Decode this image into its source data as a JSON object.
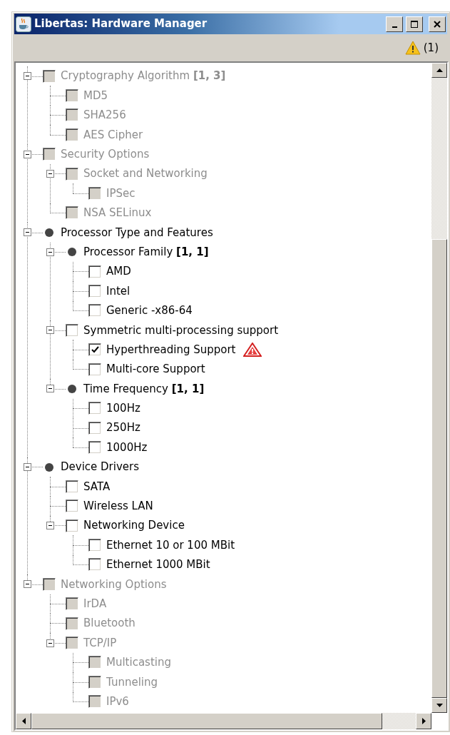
{
  "window": {
    "title": "Libertas: Hardware Manager"
  },
  "toolbar": {
    "warning_count": "(1)"
  },
  "tree": [
    {
      "label": "Cryptography Algorithm **[1, 3]**",
      "kind": "option",
      "disabled": true,
      "checked": false,
      "warning": false,
      "expanded": true,
      "children": [
        {
          "label": "MD5",
          "kind": "option",
          "disabled": true,
          "checked": false,
          "warning": false
        },
        {
          "label": "SHA256",
          "kind": "option",
          "disabled": true,
          "checked": false,
          "warning": false
        },
        {
          "label": "AES Cipher",
          "kind": "option",
          "disabled": true,
          "checked": false,
          "warning": false
        }
      ]
    },
    {
      "label": "Security Options",
      "kind": "option",
      "disabled": true,
      "checked": false,
      "warning": false,
      "expanded": true,
      "children": [
        {
          "label": "Socket and Networking",
          "kind": "option",
          "disabled": true,
          "checked": false,
          "warning": false,
          "expanded": true,
          "children": [
            {
              "label": "IPSec",
              "kind": "option",
              "disabled": true,
              "checked": false,
              "warning": false
            }
          ]
        },
        {
          "label": "NSA SELinux",
          "kind": "option",
          "disabled": true,
          "checked": false,
          "warning": false
        }
      ]
    },
    {
      "label": "Processor Type and Features",
      "kind": "group",
      "disabled": false,
      "warning": false,
      "expanded": true,
      "children": [
        {
          "label": "Processor Family **[1, 1]**",
          "kind": "group",
          "disabled": false,
          "warning": false,
          "expanded": true,
          "children": [
            {
              "label": "AMD",
              "kind": "option",
              "disabled": false,
              "checked": false,
              "warning": false
            },
            {
              "label": "Intel",
              "kind": "option",
              "disabled": false,
              "checked": false,
              "warning": false
            },
            {
              "label": "Generic -x86-64",
              "kind": "option",
              "disabled": false,
              "checked": false,
              "warning": false
            }
          ]
        },
        {
          "label": "Symmetric multi-processing support",
          "kind": "option",
          "disabled": false,
          "checked": false,
          "warning": false,
          "expanded": true,
          "children": [
            {
              "label": "Hyperthreading Support",
              "kind": "option",
              "disabled": false,
              "checked": true,
              "warning": true
            },
            {
              "label": "Multi-core Support",
              "kind": "option",
              "disabled": false,
              "checked": false,
              "warning": false
            }
          ]
        },
        {
          "label": "Time Frequency **[1, 1]**",
          "kind": "group",
          "disabled": false,
          "warning": false,
          "expanded": true,
          "children": [
            {
              "label": "100Hz",
              "kind": "option",
              "disabled": false,
              "checked": false,
              "warning": false
            },
            {
              "label": "250Hz",
              "kind": "option",
              "disabled": false,
              "checked": false,
              "warning": false
            },
            {
              "label": "1000Hz",
              "kind": "option",
              "disabled": false,
              "checked": false,
              "warning": false
            }
          ]
        }
      ]
    },
    {
      "label": "Device Drivers",
      "kind": "group",
      "disabled": false,
      "warning": false,
      "expanded": true,
      "children": [
        {
          "label": "SATA",
          "kind": "option",
          "disabled": false,
          "checked": false,
          "warning": false
        },
        {
          "label": "Wireless LAN",
          "kind": "option",
          "disabled": false,
          "checked": false,
          "warning": false
        },
        {
          "label": "Networking Device",
          "kind": "option",
          "disabled": false,
          "checked": false,
          "warning": false,
          "expanded": true,
          "children": [
            {
              "label": "Ethernet 10 or 100 MBit",
              "kind": "option",
              "disabled": false,
              "checked": false,
              "warning": false
            },
            {
              "label": "Ethernet 1000 MBit",
              "kind": "option",
              "disabled": false,
              "checked": false,
              "warning": false
            }
          ]
        }
      ]
    },
    {
      "label": "Networking Options",
      "kind": "option",
      "disabled": true,
      "checked": false,
      "warning": false,
      "expanded": true,
      "children": [
        {
          "label": "IrDA",
          "kind": "option",
          "disabled": true,
          "checked": false,
          "warning": false
        },
        {
          "label": "Bluetooth",
          "kind": "option",
          "disabled": true,
          "checked": false,
          "warning": false
        },
        {
          "label": "TCP/IP",
          "kind": "option",
          "disabled": true,
          "checked": false,
          "warning": false,
          "expanded": true,
          "children": [
            {
              "label": "Multicasting",
              "kind": "option",
              "disabled": true,
              "checked": false,
              "warning": false
            },
            {
              "label": "Tunneling",
              "kind": "option",
              "disabled": true,
              "checked": false,
              "warning": false
            },
            {
              "label": "IPv6",
              "kind": "option",
              "disabled": true,
              "checked": false,
              "warning": false
            }
          ]
        }
      ]
    }
  ]
}
